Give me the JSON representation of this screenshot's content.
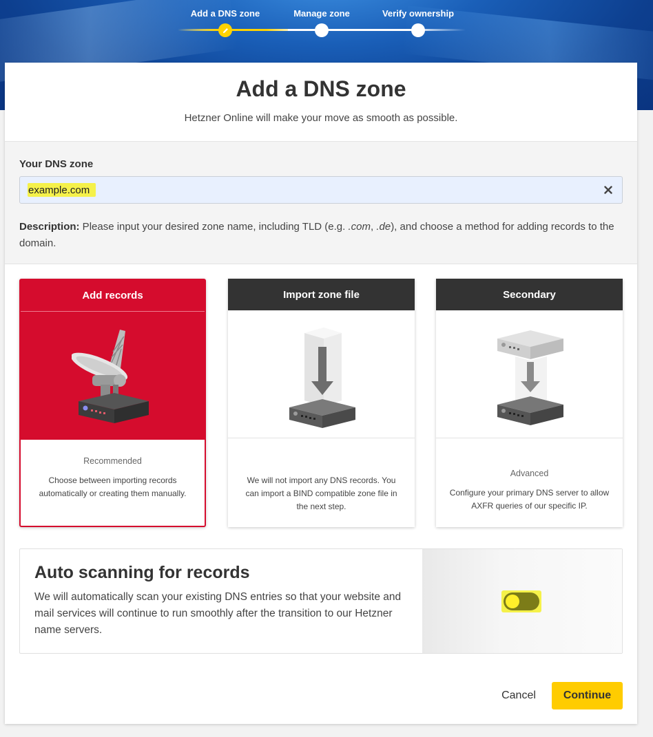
{
  "stepper": {
    "steps": [
      {
        "label": "Add a DNS zone",
        "state": "active"
      },
      {
        "label": "Manage zone",
        "state": "pending"
      },
      {
        "label": "Verify ownership",
        "state": "pending"
      }
    ]
  },
  "header": {
    "title": "Add a DNS zone",
    "subtitle": "Hetzner Online will make your move as smooth as possible."
  },
  "zone_form": {
    "label": "Your DNS zone",
    "value": "example.com",
    "clear_icon": "close-icon",
    "description_label": "Description:",
    "description_text_1": " Please input your desired zone name, including TLD (e.g. ",
    "description_tld_1": ".com",
    "description_sep": ", ",
    "description_tld_2": ".de",
    "description_text_2": "), and choose a method for adding records to the domain."
  },
  "options": [
    {
      "title": "Add records",
      "tag": "Recommended",
      "description": "Choose between importing records automatically or creating them manually.",
      "icon": "satellite-dish-server-icon",
      "selected": true
    },
    {
      "title": "Import zone file",
      "tag": "",
      "description": "We will not import any DNS records. You can import a BIND compatible zone file in the next step.",
      "icon": "import-server-icon",
      "selected": false
    },
    {
      "title": "Secondary",
      "tag": "Advanced",
      "description": "Configure your primary DNS server to allow AXFR queries of our specific IP.",
      "icon": "secondary-server-icon",
      "selected": false
    }
  ],
  "auto_scan": {
    "title": "Auto scanning for records",
    "text": "We will automatically scan your existing DNS entries so that your website and mail services will continue to run smoothly after the transition to our Hetzner name servers.",
    "toggle_on": false
  },
  "footer": {
    "cancel_label": "Cancel",
    "continue_label": "Continue"
  },
  "colors": {
    "accent_red": "#d50c2d",
    "accent_yellow": "#ffcc00",
    "header_dark": "#333333",
    "hero_blue": "#1a5fb8"
  }
}
